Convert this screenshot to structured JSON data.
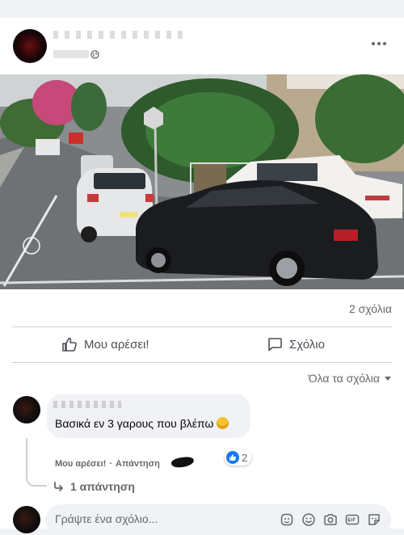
{
  "post": {
    "comment_count": "2 σχόλια",
    "actions": {
      "like_label": "Μου αρέσει!",
      "comment_label": "Σχόλιο"
    }
  },
  "comments": {
    "sort_label": "Όλα τα σχόλια",
    "items": [
      {
        "text": "Βασικά εν 3 γαρους που βλέπω",
        "like_action": "Μου αρέσει!",
        "separator": "·",
        "reply_action": "Απάντηση",
        "reaction_count": "2",
        "replies_label": "1 απάντηση"
      }
    ]
  },
  "composer": {
    "placeholder": "Γράψτε ένα σχόλιο..."
  },
  "icons": [
    "more-icon",
    "globe-icon",
    "like-icon",
    "comment-icon",
    "caret-down-icon",
    "reply-arrow-icon",
    "sticker-icon",
    "emoji-icon",
    "camera-icon",
    "gif-icon",
    "avatar-sticker-icon"
  ],
  "colors": {
    "accent": "#1877f2",
    "secondary_text": "#65676b",
    "bubble": "#f0f2f5"
  }
}
